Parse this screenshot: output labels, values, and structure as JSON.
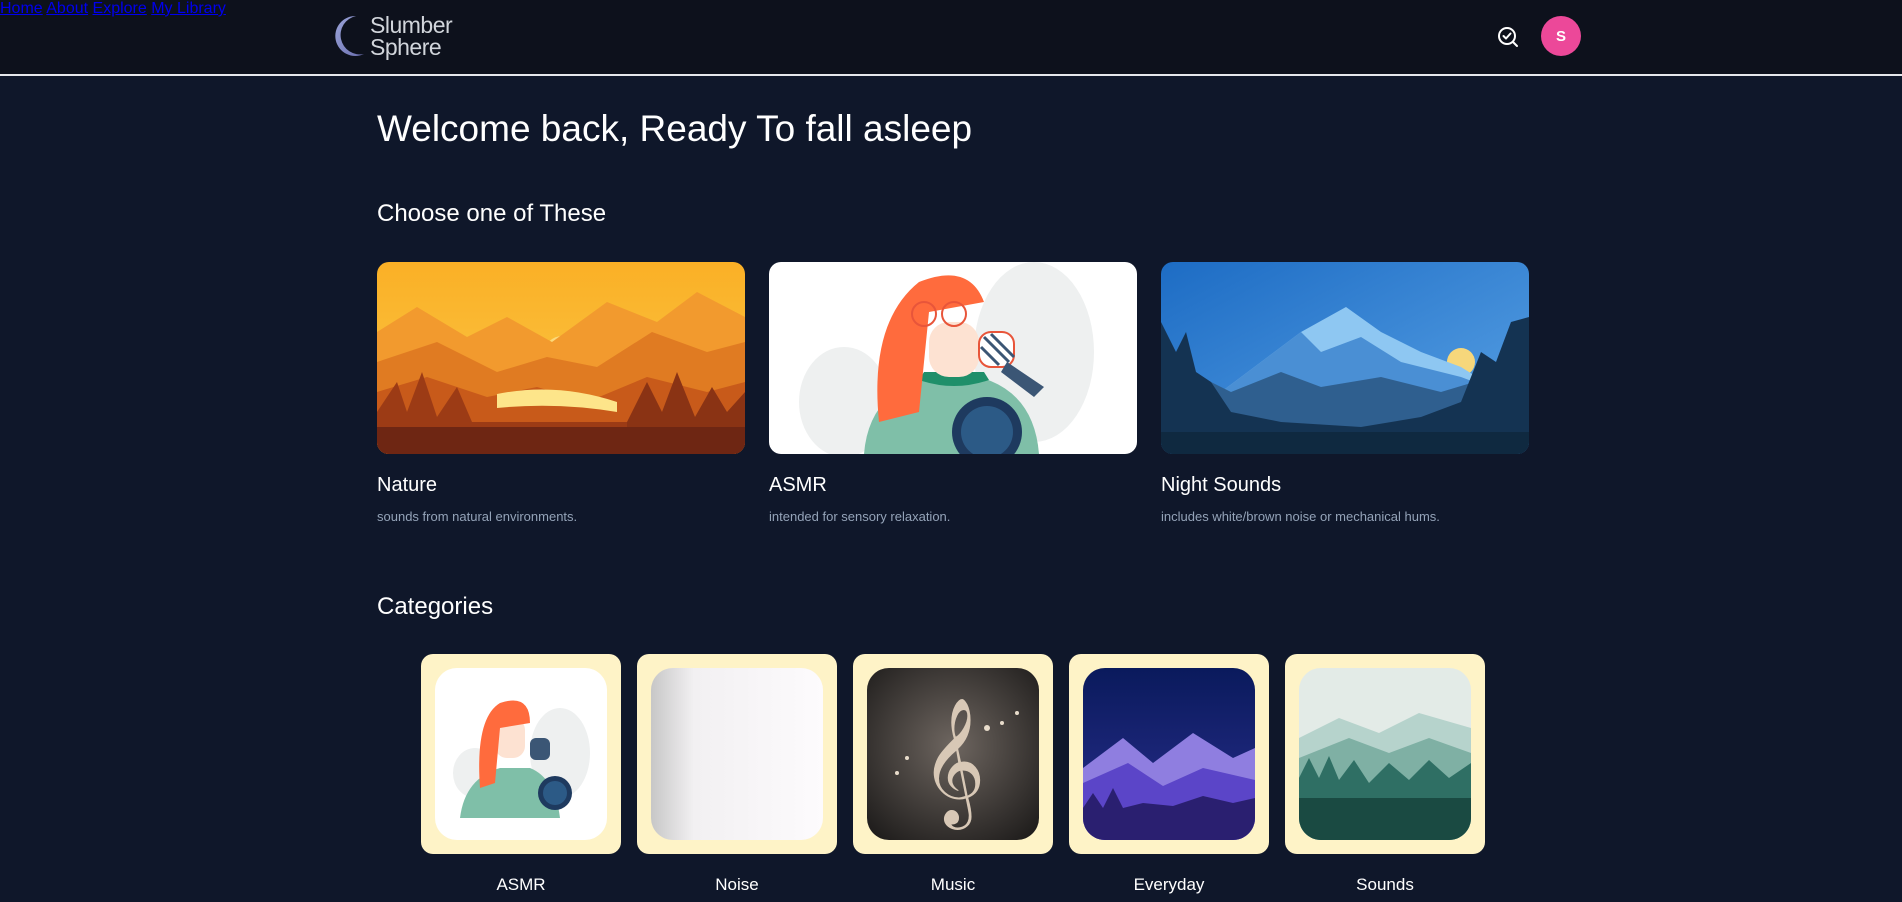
{
  "brand": {
    "line1": "Slumber",
    "line2": "Sphere"
  },
  "nav": [
    {
      "label": "Home"
    },
    {
      "label": "About"
    },
    {
      "label": "Explore"
    },
    {
      "label": "My Library"
    }
  ],
  "user": {
    "initial": "S"
  },
  "welcome": "Welcome back, Ready To fall asleep",
  "choose_title": "Choose one of These",
  "features": [
    {
      "title": "Nature",
      "desc": "sounds from natural environments."
    },
    {
      "title": "ASMR",
      "desc": "intended for sensory relaxation."
    },
    {
      "title": "Night Sounds",
      "desc": "includes white/brown noise or mechanical hums."
    }
  ],
  "categories_title": "Categories",
  "categories": [
    {
      "label": "ASMR"
    },
    {
      "label": "Noise"
    },
    {
      "label": "Music"
    },
    {
      "label": "Everyday"
    },
    {
      "label": "Sounds"
    }
  ],
  "colors": {
    "background": "#0f172a",
    "header": "#0d111c",
    "avatar": "#ec4899",
    "card_frame": "#fef3c7"
  }
}
